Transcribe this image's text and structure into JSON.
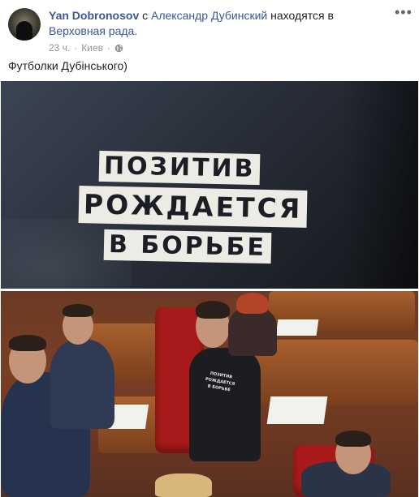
{
  "post": {
    "author": "Yan Dobronosov",
    "with_word": "с",
    "tagged_person": "Александр Дубинский",
    "location_phrase": "находятся в",
    "location": "Верховная рада.",
    "time": "23 ч.",
    "separator": "·",
    "city": "Киев",
    "privacy_icon": "globe-icon",
    "more_icon": "•••",
    "text": "Футболки Дубінського)"
  },
  "photos": {
    "shirt_slogan": {
      "line1": "ПОЗИТИВ",
      "line2": "РОЖДАЕТСЯ",
      "line3": "В БОРЬБЕ"
    }
  },
  "colors": {
    "link": "#385898",
    "meta": "#90949c",
    "text": "#1d2129"
  }
}
